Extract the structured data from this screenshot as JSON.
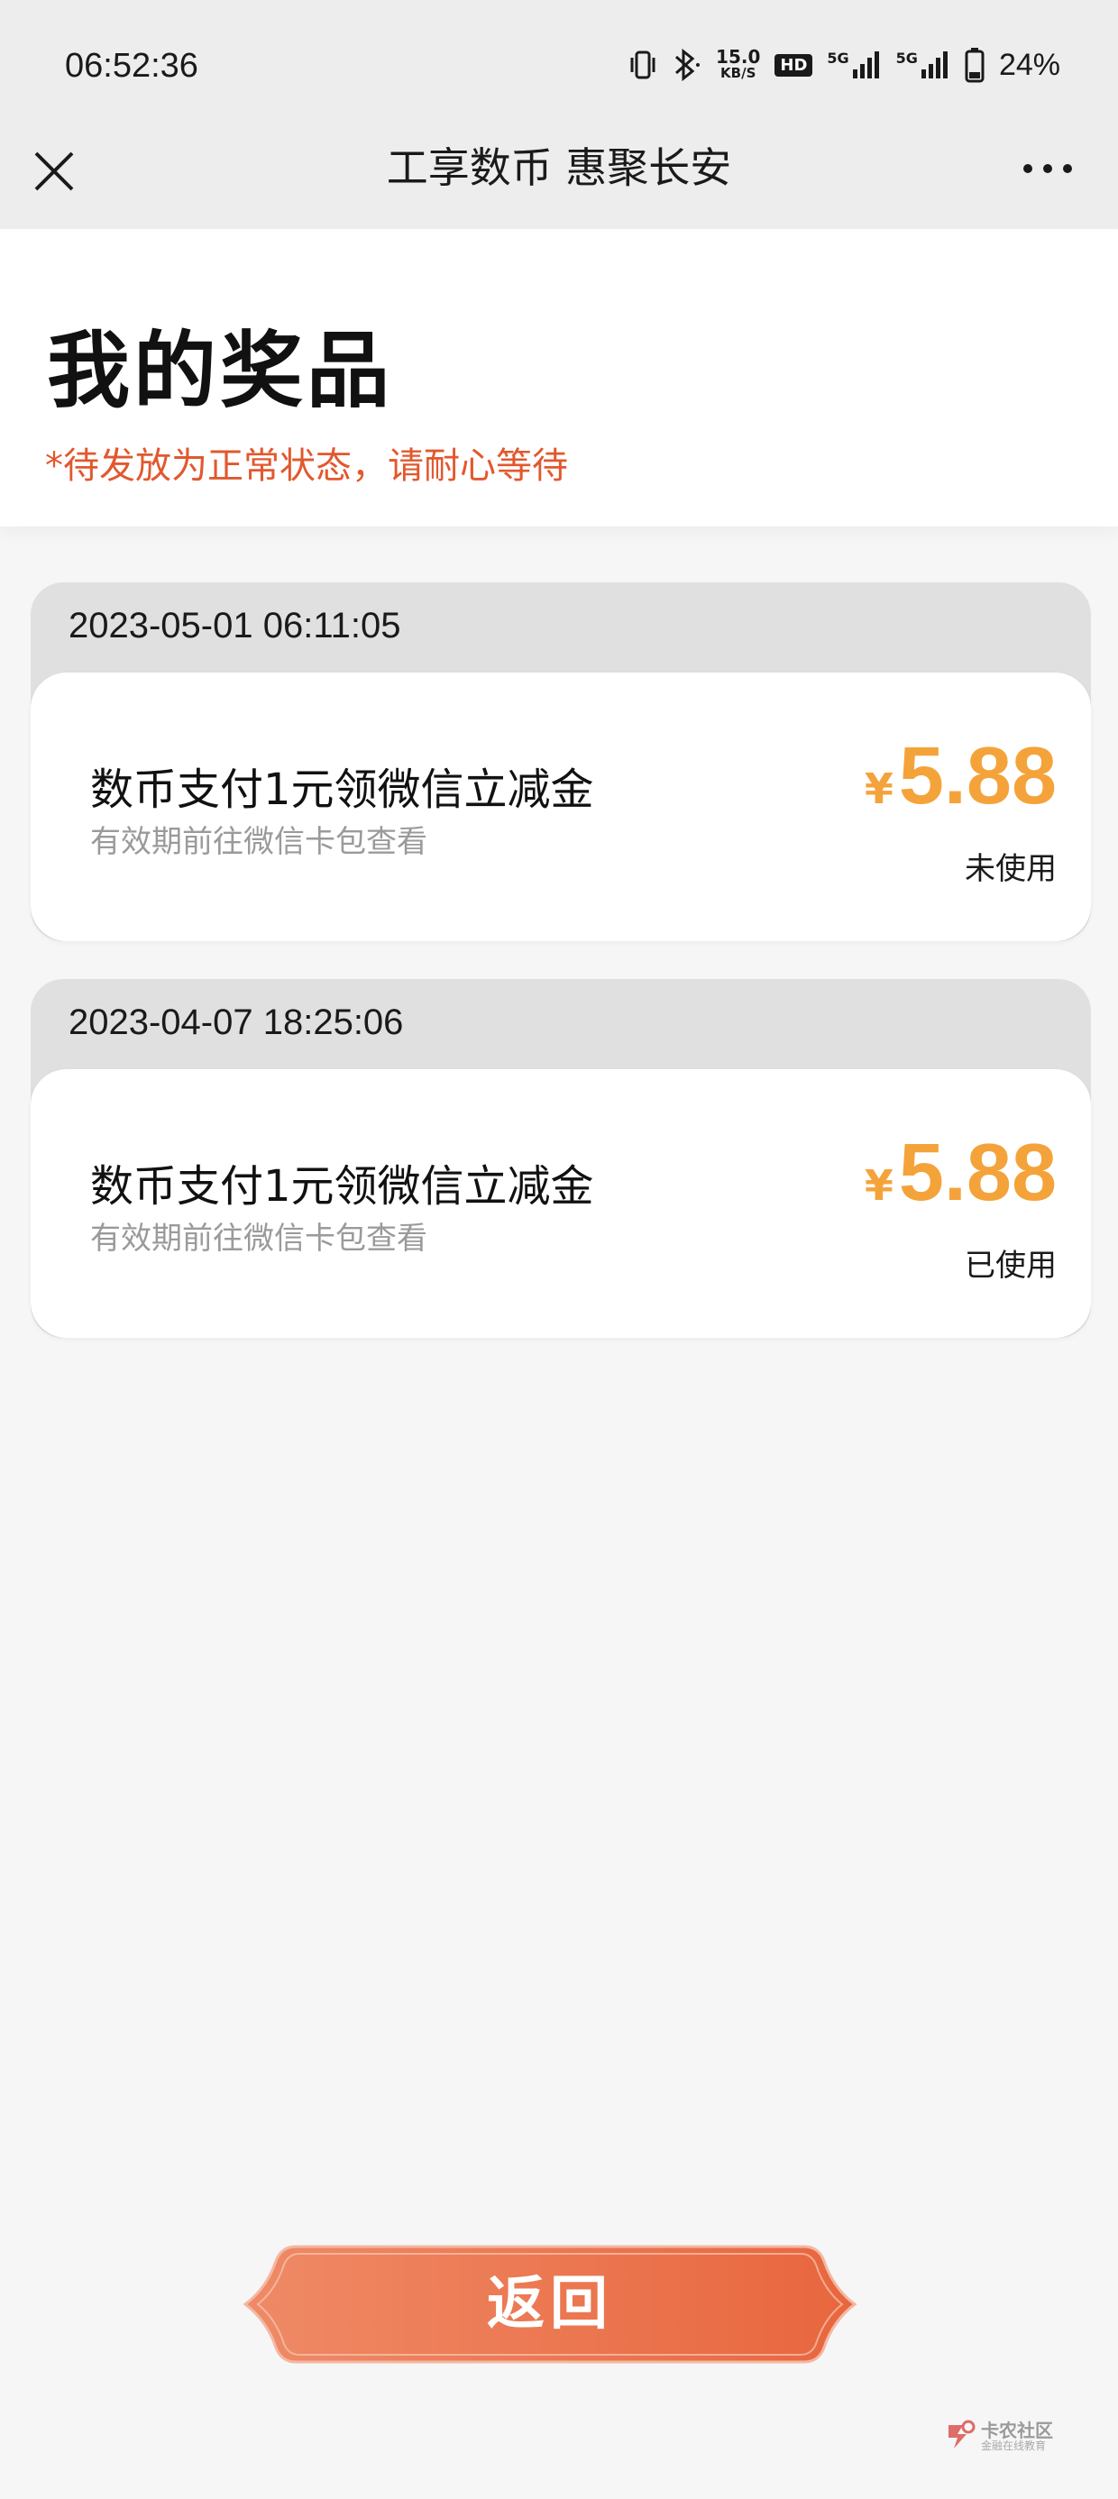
{
  "status_bar": {
    "time": "06:52:36",
    "net_speed_value": "15.0",
    "net_speed_unit": "KB/S",
    "hd_badge": "HD",
    "signal_1": "5G",
    "signal_2": "5G",
    "battery": "24%"
  },
  "nav": {
    "title": "工享数币 惠聚长安",
    "close_icon": "close-icon",
    "more_icon": "more-icon"
  },
  "header": {
    "title": "我的奖品",
    "notice": "*待发放为正常状态，请耐心等待"
  },
  "prizes": [
    {
      "date": "2023-05-01 06:11:05",
      "name": "数币支付1元领微信立减金",
      "desc": "有效期前往微信卡包查看",
      "currency": "¥",
      "amount": "5.88",
      "status": "未使用"
    },
    {
      "date": "2023-04-07 18:25:06",
      "name": "数币支付1元领微信立减金",
      "desc": "有效期前往微信卡包查看",
      "currency": "¥",
      "amount": "5.88",
      "status": "已使用"
    }
  ],
  "back_button": {
    "label": "返回"
  },
  "watermark": {
    "name": "卡农社区",
    "sub": "金融在线教育"
  },
  "colors": {
    "accent_orange": "#f4a33a",
    "notice_red": "#e2582e",
    "button_start": "#ef8a66",
    "button_end": "#e8663e"
  }
}
